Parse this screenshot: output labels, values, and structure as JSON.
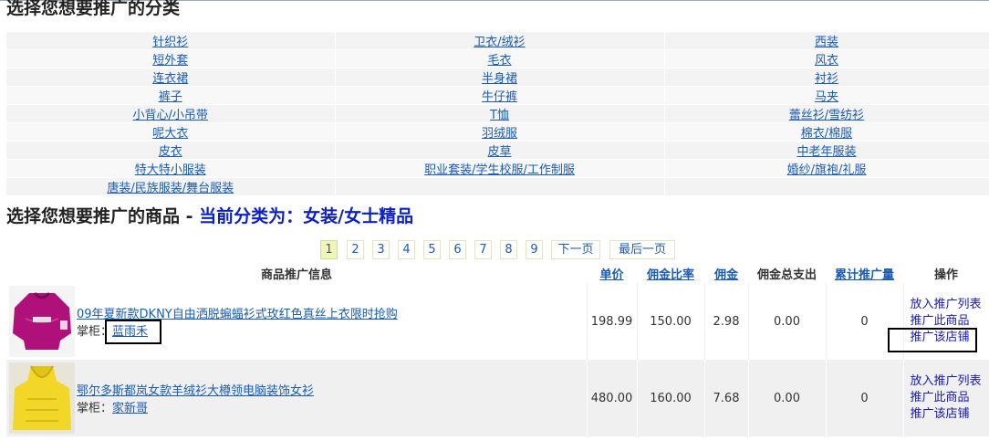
{
  "section1_title": "选择您想要推广的分类",
  "categories": [
    [
      "针织衫",
      "卫衣/绒衫",
      "西装"
    ],
    [
      "短外套",
      "毛衣",
      "风衣"
    ],
    [
      "连衣裙",
      "半身裙",
      "衬衫"
    ],
    [
      "裤子",
      "牛仔裤",
      "马夹"
    ],
    [
      "小背心/小吊带",
      "T恤",
      "蕾丝衫/雪纺衫"
    ],
    [
      "呢大衣",
      "羽绒服",
      "棉衣/棉服"
    ],
    [
      "皮衣",
      "皮草",
      "中老年服装"
    ],
    [
      "特大特小服装",
      "职业套装/学生校服/工作制服",
      "婚纱/旗袍/礼服"
    ],
    [
      "唐装/民族服装/舞台服装",
      "",
      ""
    ]
  ],
  "section2": {
    "title": "选择您想要推广的商品 - ",
    "current": "当前分类为：女装/女士精品"
  },
  "pager": {
    "pages": [
      "1",
      "2",
      "3",
      "4",
      "5",
      "6",
      "7",
      "8",
      "9"
    ],
    "next": "下一页",
    "last": "最后一页",
    "active": "1"
  },
  "table": {
    "headers": {
      "info": "商品推广信息",
      "price": "单价",
      "rate": "佣金比率",
      "commission": "佣金",
      "total": "佣金总支出",
      "volume": "累计推广量",
      "ops": "操作"
    },
    "rows": [
      {
        "title": "09年夏新款DKNY自由洒脱蝙蝠衫式玫红色真丝上衣限时抢购",
        "shop_label": "掌柜：",
        "shop": "蓝雨禾",
        "price": "198.99",
        "rate": "150.00",
        "commission": "2.98",
        "total": "0.00",
        "volume": "0",
        "op1": "放入推广列表",
        "op2": "推广此商品",
        "op3": "推广该店铺"
      },
      {
        "title": "鄂尔多斯都岚女款羊绒衫大樽领电脑装饰女衫",
        "shop_label": "掌柜：",
        "shop": "家新哥",
        "price": "480.00",
        "rate": "160.00",
        "commission": "7.68",
        "total": "0.00",
        "volume": "0",
        "op1": "放入推广列表",
        "op2": "推广此商品",
        "op3": "推广该店铺"
      }
    ]
  }
}
